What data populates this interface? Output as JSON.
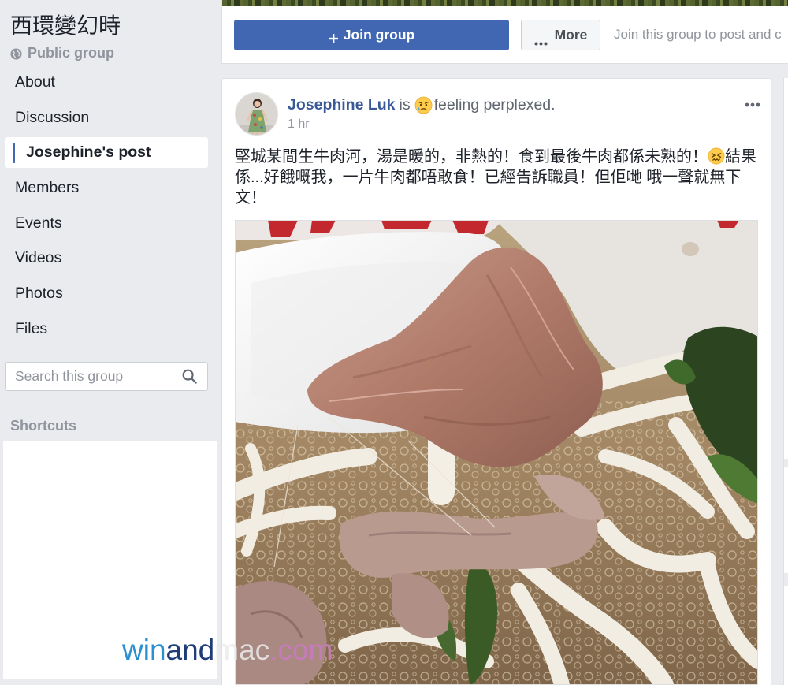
{
  "group": {
    "name": "西環變幻時",
    "privacy": "Public group",
    "privacy_icon": "globe-icon"
  },
  "sidebar": {
    "nav": [
      {
        "label": "About"
      },
      {
        "label": "Discussion"
      },
      {
        "label": "Josephine's post",
        "active": true
      },
      {
        "label": "Members"
      },
      {
        "label": "Events"
      },
      {
        "label": "Videos"
      },
      {
        "label": "Photos"
      },
      {
        "label": "Files"
      }
    ],
    "search": {
      "placeholder": "Search this group",
      "value": "",
      "icon": "search-icon"
    },
    "shortcuts_title": "Shortcuts"
  },
  "actions": {
    "join_label": "Join group",
    "join_icon": "plus-icon",
    "more_label": "More",
    "more_icon": "more-dots-icon",
    "hint": "Join this group to post and c"
  },
  "post": {
    "author": "Josephine Luk",
    "is": "is",
    "feeling_icon": "perplexed-face-icon",
    "feeling": "feeling perplexed.",
    "time": "1 hr",
    "options_icon": "ellipsis-icon",
    "text_before_emoji": "堅城某間生牛肉河，湯是暖的，非熱的！食到最後牛肉都係未熟的！",
    "text_emoji_icon": "confounded-face-icon",
    "text_after_emoji": "結果係...好餓嘅我，一片牛肉都唔敢食！已經告訴職員！但佢哋 哦一聲就無下文！"
  },
  "watermark": {
    "parts": [
      "win",
      "and",
      "mac",
      ".com"
    ],
    "colors": [
      "#2b8fd1",
      "#1d3c78",
      "#ececec",
      "#c77cba"
    ]
  },
  "theme": {
    "page_bg": "#e9ebee",
    "accent": "#4267b2",
    "link": "#385898",
    "muted": "#90949c",
    "secondary": "#606770",
    "text": "#1d2129",
    "card_border": "#dddfe2"
  }
}
